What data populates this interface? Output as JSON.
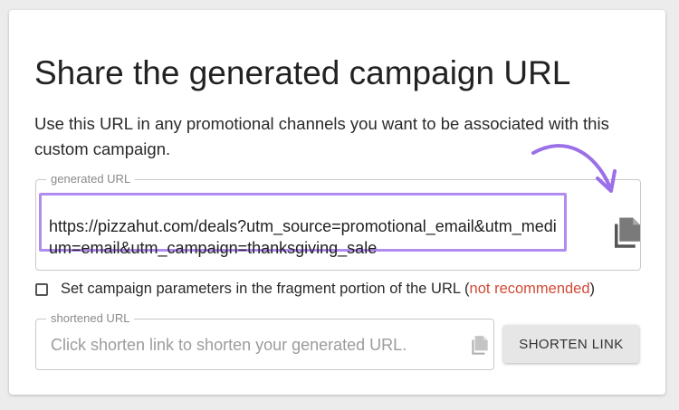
{
  "title": "Share the generated campaign URL",
  "description": "Use this URL in any promotional channels you want to be associated with this custom campaign.",
  "generated_url": {
    "legend": "generated URL",
    "value": "https://pizzahut.com/deals?utm_source=promotional_email&utm_medium=email&utm_campaign=thanksgiving_sale",
    "copy_icon": "copy-icon"
  },
  "fragment_option": {
    "checked": false,
    "label": "Set campaign parameters in the fragment portion of the URL (",
    "warning": "not recommended",
    "label_close": ")"
  },
  "shortened_url": {
    "legend": "shortened URL",
    "placeholder": "Click shorten link to shorten your generated URL.",
    "copy_icon": "copy-icon"
  },
  "shorten_button": {
    "label": "SHORTEN LINK"
  },
  "colors": {
    "highlight": "#b18cf0",
    "warning": "#d24a36",
    "arrow": "#9b6fe8"
  }
}
